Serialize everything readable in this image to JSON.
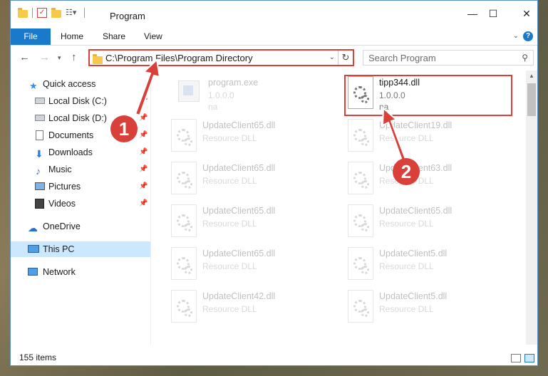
{
  "title": "Program",
  "ribbon": {
    "file": "File",
    "home": "Home",
    "share": "Share",
    "view": "View"
  },
  "address": {
    "path": "C:\\Program Files\\Program Directory"
  },
  "search": {
    "placeholder": "Search Program"
  },
  "sidebar": {
    "items": [
      {
        "label": "Quick access",
        "icon": "star-icon"
      },
      {
        "label": "Local Disk (C:)",
        "icon": "drive-icon"
      },
      {
        "label": "Local Disk (D:)",
        "icon": "drive-icon"
      },
      {
        "label": "Documents",
        "icon": "documents-icon"
      },
      {
        "label": "Downloads",
        "icon": "download-icon"
      },
      {
        "label": "Music",
        "icon": "music-icon"
      },
      {
        "label": "Pictures",
        "icon": "pictures-icon"
      },
      {
        "label": "Videos",
        "icon": "videos-icon"
      },
      {
        "label": "OneDrive",
        "icon": "cloud-icon"
      },
      {
        "label": "This PC",
        "icon": "computer-icon"
      },
      {
        "label": "Network",
        "icon": "network-icon"
      }
    ]
  },
  "files": [
    {
      "name": "program.exe",
      "sub": "1.0.0.0",
      "sub2": "na"
    },
    {
      "name": "tipp344.dll",
      "sub": "1.0.0.0",
      "sub2": "na"
    },
    {
      "name": "UpdateClient65.dll",
      "sub": "Resource DLL"
    },
    {
      "name": "UpdateClient19.dll",
      "sub": "Resource DLL"
    },
    {
      "name": "UpdateClient65.dll",
      "sub": "Resource DLL"
    },
    {
      "name": "UpdateClient63.dll",
      "sub": "Resource DLL"
    },
    {
      "name": "UpdateClient65.dll",
      "sub": "Resource DLL"
    },
    {
      "name": "UpdateClient65.dll",
      "sub": "Resource DLL"
    },
    {
      "name": "UpdateClient65.dll",
      "sub": "Resource DLL"
    },
    {
      "name": "UpdateClient5.dll",
      "sub": "Resource DLL"
    },
    {
      "name": "UpdateClient42.dll",
      "sub": "Resource DLL"
    },
    {
      "name": "UpdateClient5.dll",
      "sub": "Resource DLL"
    }
  ],
  "status": {
    "items": "155 items"
  },
  "callouts": {
    "one": "1",
    "two": "2"
  },
  "colors": {
    "accent": "#1979ca",
    "highlight": "#d9403a",
    "selected": "#cce8ff"
  }
}
